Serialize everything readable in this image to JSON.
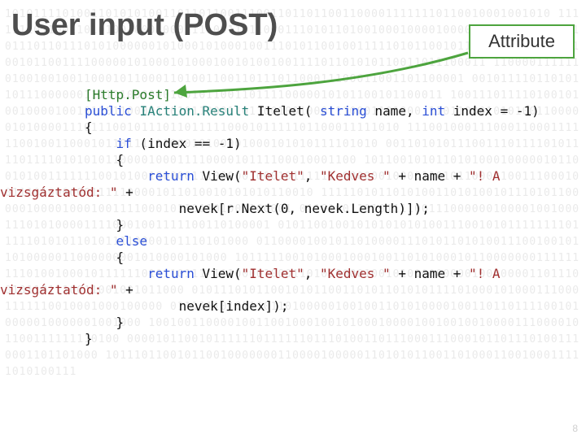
{
  "title": "User input (POST)",
  "callout": "Attribute",
  "page_number": "8",
  "background": "1010111101001101010100110110110011100110101100110000111111101100100010010\n1111111011001101010010001000111100110110001110101100010000000001000000010\n1001010111011001010100001010100001010001001110101100100011110101100",
  "code": {
    "attr": "[Http.Post]",
    "l2_pub": "public",
    "l2_type": "IAction.Result",
    "l2_name": " Itelet( ",
    "l2_kw1": "string",
    "l2_mid": " name, ",
    "l2_kw2": "int",
    "l2_end": " index = -1)",
    "l3": "{",
    "l4_if": "    if",
    "l4_rest": " (index == -1)",
    "l5": "    {",
    "l6_ret": "        return",
    "l6_rest": " View(",
    "l6_s1": "\"Itelet\"",
    "l6_c": ", ",
    "l6_s2": "\"Kedves \"",
    "l6_end": " + name + ",
    "l6_s3": "\"! A",
    "l7_s": "vizsgáztatód: \"",
    "l7_end": " + ",
    "l8": "            nevek[r.Next(0, nevek.Length)]);",
    "l9": "    }",
    "l10": "    else",
    "l11": "    {",
    "l12_ret": "        return",
    "l12_rest": " View(",
    "l12_s1": "\"Itelet\"",
    "l12_c": ", ",
    "l12_s2": "\"Kedves \"",
    "l12_end": " + name + ",
    "l12_s3": "\"! A",
    "l13_s": "vizsgáztatód: \"",
    "l13_end": " +",
    "l14": "            nevek[index]);",
    "l15": "    }",
    "l16": "}"
  }
}
